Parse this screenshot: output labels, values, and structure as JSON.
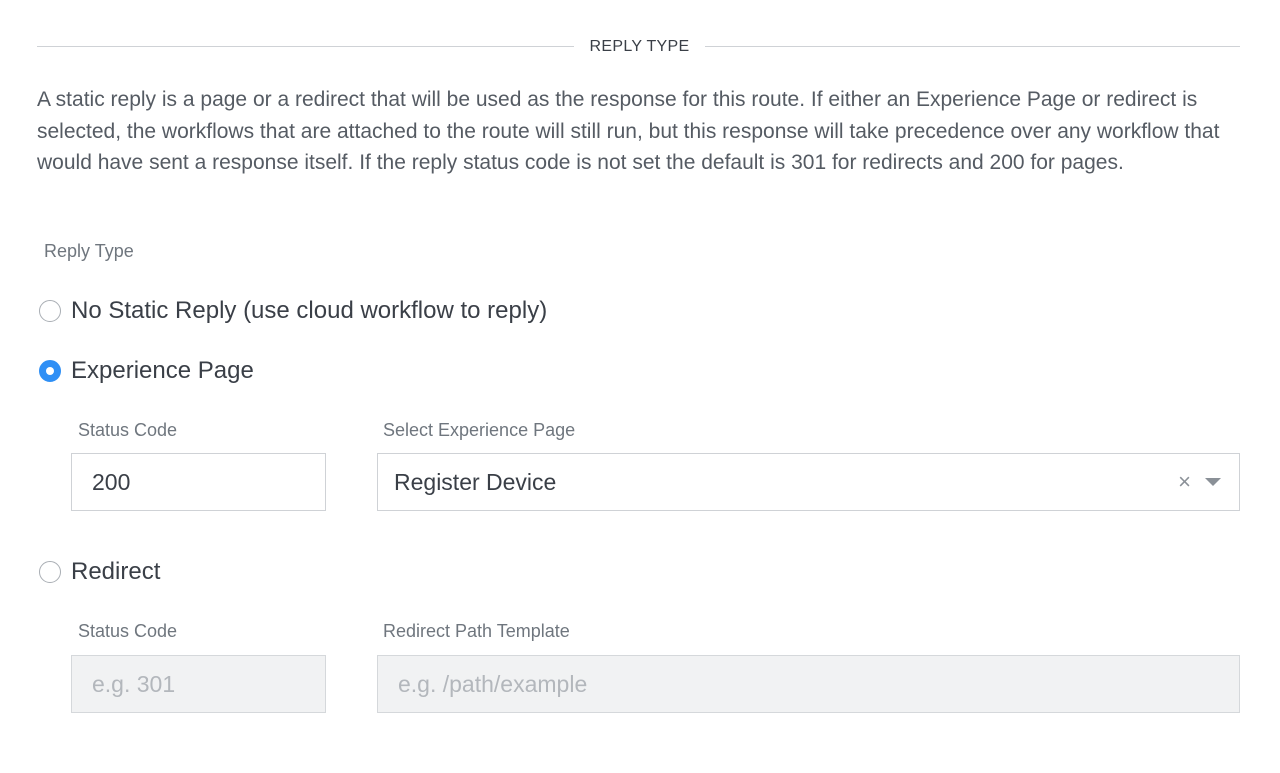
{
  "section": {
    "title": "REPLY TYPE"
  },
  "description": "A static reply is a page or a redirect that will be used as the response for this route. If either an Experience Page or redirect is selected, the workflows that are attached to the route will still run, but this response will take precedence over any workflow that would have sent a response itself. If the reply status code is not set the default is 301 for redirects and 200 for pages.",
  "reply_type": {
    "label": "Reply Type",
    "selected": "experience_page",
    "options": [
      {
        "id": "none",
        "label": "No Static Reply (use cloud workflow to reply)"
      },
      {
        "id": "experience_page",
        "label": "Experience Page"
      },
      {
        "id": "redirect",
        "label": "Redirect"
      }
    ]
  },
  "experience_page": {
    "status_code_label": "Status Code",
    "status_code_value": "200",
    "page_label": "Select Experience Page",
    "page_value": "Register Device",
    "clear_icon": "×"
  },
  "redirect": {
    "status_code_label": "Status Code",
    "status_code_placeholder": "e.g. 301",
    "path_label": "Redirect Path Template",
    "path_placeholder": "e.g. /path/example"
  },
  "colors": {
    "accent": "#2f8ff5",
    "text": "#3a3f47",
    "muted_label": "#6f767e",
    "border": "#cfd2d6",
    "disabled_bg": "#f1f2f3"
  }
}
